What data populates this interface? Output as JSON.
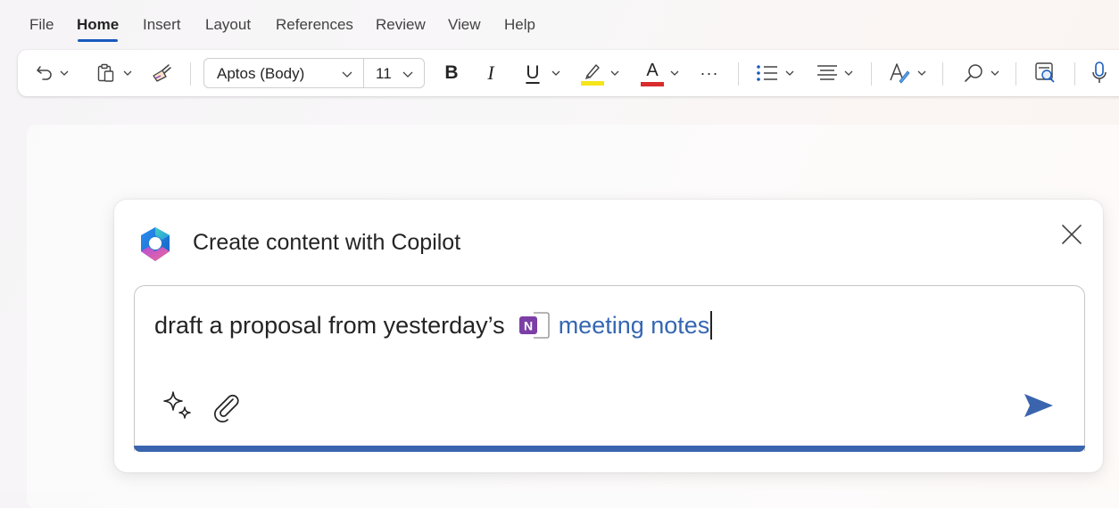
{
  "menu": {
    "items": [
      "File",
      "Home",
      "Insert",
      "Layout",
      "References",
      "Review",
      "View",
      "Help"
    ],
    "active": "Home"
  },
  "ribbon": {
    "font_name": "Aptos (Body)",
    "font_size": "11",
    "bold_label": "B",
    "italic_label": "I",
    "underline_label": "U",
    "font_color_label": "A",
    "more_label": "···",
    "highlight_color": "#f5e51b",
    "font_color": "#d92c2c",
    "icons": [
      "undo-icon",
      "paste-icon",
      "format-painter-icon",
      "highlighter-icon",
      "bullets-icon",
      "align-icon",
      "styles-icon",
      "find-icon",
      "editor-icon",
      "dictate-icon"
    ]
  },
  "copilot": {
    "title": "Create content with Copilot",
    "prompt_text": "draft a proposal from yesterday’s",
    "reference_label": "meeting notes",
    "reference_icon_letter": "N",
    "accent": "#3a65ae",
    "reference_color": "#3566b1",
    "onenote_color": "#7b3fa6"
  }
}
